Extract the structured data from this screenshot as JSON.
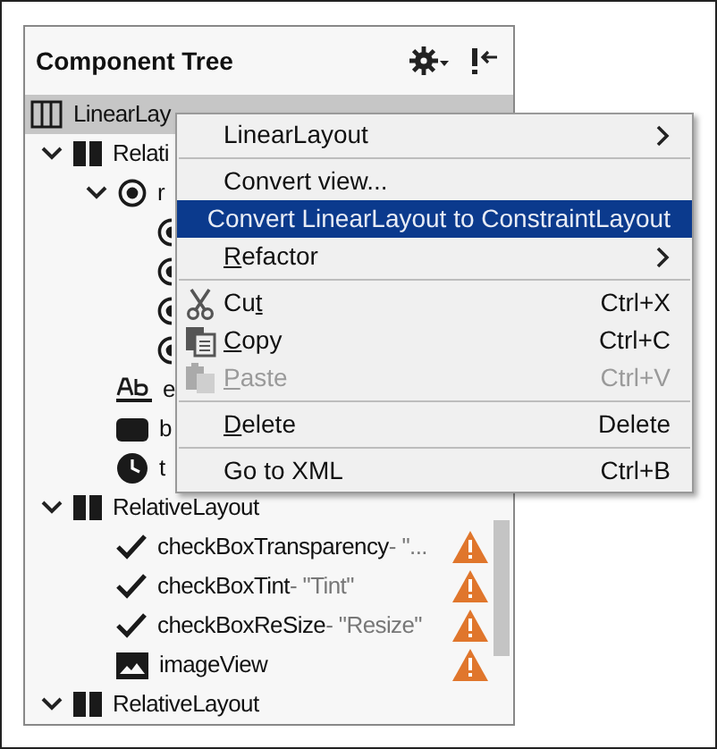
{
  "panel": {
    "title": "Component Tree"
  },
  "tree": [
    {
      "kind": "linear",
      "name": "LinearLay",
      "selected": true,
      "children": [
        {
          "kind": "relative",
          "name": "Relati",
          "expanded": true,
          "selected": false,
          "children": [
            {
              "kind": "radiogroup",
              "name": "r",
              "expanded": true,
              "selected": false,
              "children": [
                {
                  "kind": "radio",
                  "selected": false
                },
                {
                  "kind": "radio",
                  "selected": false
                },
                {
                  "kind": "radio",
                  "selected": false
                },
                {
                  "kind": "radio",
                  "selected": false
                }
              ]
            },
            {
              "kind": "text",
              "name": "e",
              "selected": false
            },
            {
              "kind": "button",
              "name": "b",
              "selected": false
            },
            {
              "kind": "clock",
              "name": "t",
              "selected": false
            }
          ]
        },
        {
          "kind": "relative",
          "name": "RelativeLayout",
          "expanded": true,
          "selected": false,
          "children": [
            {
              "kind": "checkbox",
              "name": "checkBoxTransparency",
              "detail": "- \"...",
              "warning": true,
              "selected": false
            },
            {
              "kind": "checkbox",
              "name": "checkBoxTint",
              "detail": "- \"Tint\"",
              "warning": true,
              "selected": false
            },
            {
              "kind": "checkbox",
              "name": "checkBoxReSize",
              "detail": "- \"Resize\"",
              "warning": true,
              "selected": false
            },
            {
              "kind": "image",
              "name": "imageView",
              "warning": true,
              "selected": false
            }
          ]
        },
        {
          "kind": "relative",
          "name": "RelativeLayout",
          "expanded": true,
          "selected": false
        }
      ]
    }
  ],
  "menu": [
    {
      "kind": "item",
      "label": [
        {
          "text": "LinearLayout",
          "underline": false
        }
      ],
      "submenu": true,
      "selected": false,
      "disabled": false
    },
    {
      "kind": "separator"
    },
    {
      "kind": "item",
      "label": [
        {
          "text": "Convert view...",
          "underline": false
        }
      ],
      "submenu": false,
      "selected": false,
      "disabled": false
    },
    {
      "kind": "item",
      "label": [
        {
          "text": "Convert LinearLayout to ConstraintLayout",
          "underline": false
        }
      ],
      "submenu": false,
      "selected": true,
      "disabled": false
    },
    {
      "kind": "item",
      "label": [
        {
          "text": "R",
          "underline": true
        },
        {
          "text": "efactor",
          "underline": false
        }
      ],
      "submenu": true,
      "selected": false,
      "disabled": false
    },
    {
      "kind": "separator"
    },
    {
      "kind": "cut",
      "label": [
        {
          "text": "Cu",
          "underline": false
        },
        {
          "text": "t",
          "underline": true
        }
      ],
      "shortcut": "Ctrl+X",
      "submenu": false,
      "selected": false,
      "disabled": false
    },
    {
      "kind": "copy",
      "label": [
        {
          "text": "C",
          "underline": true
        },
        {
          "text": "opy",
          "underline": false
        }
      ],
      "shortcut": "Ctrl+C",
      "submenu": false,
      "selected": false,
      "disabled": false
    },
    {
      "kind": "paste",
      "label": [
        {
          "text": "P",
          "underline": true
        },
        {
          "text": "aste",
          "underline": false
        }
      ],
      "shortcut": "Ctrl+V",
      "submenu": false,
      "selected": false,
      "disabled": true
    },
    {
      "kind": "separator"
    },
    {
      "kind": "item",
      "label": [
        {
          "text": "D",
          "underline": true
        },
        {
          "text": "elete",
          "underline": false
        }
      ],
      "shortcut": "Delete",
      "submenu": false,
      "selected": false,
      "disabled": false
    },
    {
      "kind": "separator"
    },
    {
      "kind": "item",
      "label": [
        {
          "text": "Go to XML",
          "underline": false
        }
      ],
      "shortcut": "Ctrl+B",
      "submenu": false,
      "selected": false,
      "disabled": false
    }
  ]
}
